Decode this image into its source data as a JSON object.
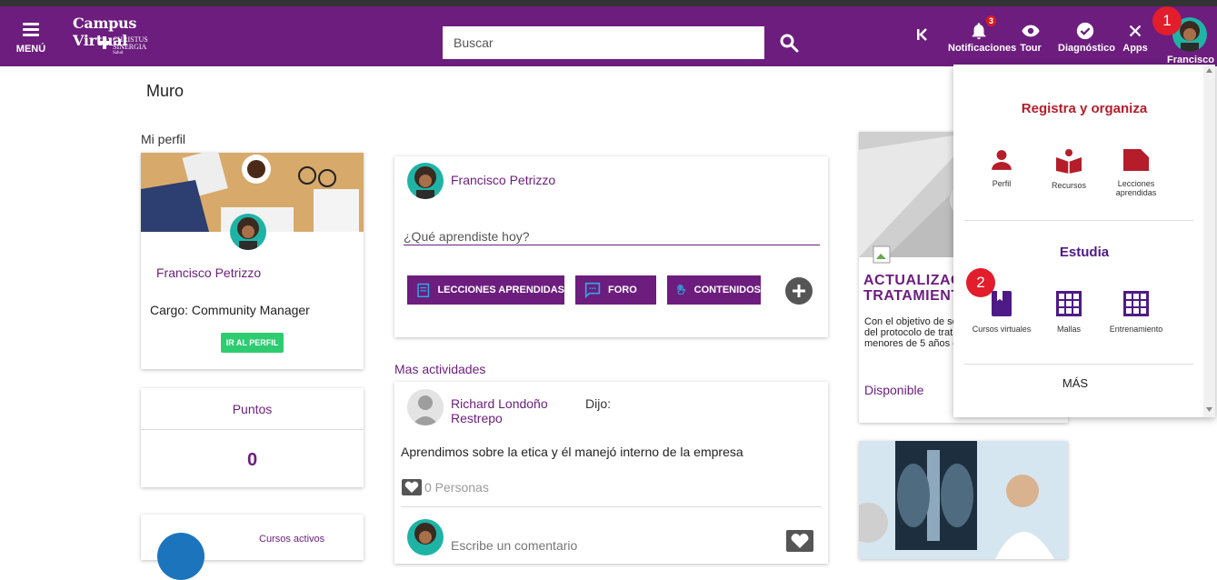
{
  "header": {
    "menu_label": "MENÚ",
    "brand_title": "Campus Virtual",
    "brand_sub1": "CHRISTUS",
    "brand_sub2": "SINERGIA",
    "brand_sub3": "Salud",
    "search_placeholder": "Buscar",
    "notifications_label": "Notificaciones",
    "notifications_count": "3",
    "tour_label": "Tour",
    "diagnostico_label": "Diagnóstico",
    "apps_label": "Apps",
    "user_label": "Francisco",
    "color": "#6c1d7e"
  },
  "steps": {
    "one": "1",
    "two": "2"
  },
  "page": {
    "title": "Muro"
  },
  "profile": {
    "section_label": "Mi perfil",
    "name": "Francisco Petrizzo",
    "cargo": "Cargo: Community Manager",
    "button": "IR AL PERFIL"
  },
  "points": {
    "label": "Puntos",
    "value": "0"
  },
  "courses": {
    "label": "Cursos activos"
  },
  "composer": {
    "user": "Francisco Petrizzo",
    "placeholder": "¿Qué aprendiste hoy?",
    "buttons": [
      "LECCIONES APRENDIDAS",
      "FORO",
      "CONTENIDOS"
    ]
  },
  "activities": {
    "section_label": "Mas actividades",
    "post": {
      "author_line1": "Richard Londoño",
      "author_line2": "Restrepo",
      "said": "Dijo:",
      "text": "Aprendimos sobre la etica y él manejó interno de la empresa",
      "likes": "0 Personas",
      "comment_placeholder": "Escribe un comentario"
    }
  },
  "news": {
    "title_line1": "ACTUALIZAC",
    "title_line2": "TRATAMIENT",
    "body_line1": "Con el objetivo de so",
    "body_line2": "del protocolo de trat",
    "body_line3": "menores de 5 años d",
    "status": "Disponible"
  },
  "dropdown": {
    "section1": "Registra y organiza",
    "items1": [
      {
        "label": "Perfil",
        "icon": "person-icon"
      },
      {
        "label": "Recursos",
        "icon": "book-open-icon"
      },
      {
        "label": "Lecciones aprendidas",
        "icon": "label-icon"
      }
    ],
    "section2": "Estudia",
    "items2": [
      {
        "label": "Cursos virtuales",
        "icon": "book-icon"
      },
      {
        "label": "Mallas",
        "icon": "grid-icon"
      },
      {
        "label": "Entrenamiento",
        "icon": "grid-icon"
      }
    ],
    "more": "MÁS",
    "red": "#b51d2a",
    "purple": "#4e1a86"
  }
}
